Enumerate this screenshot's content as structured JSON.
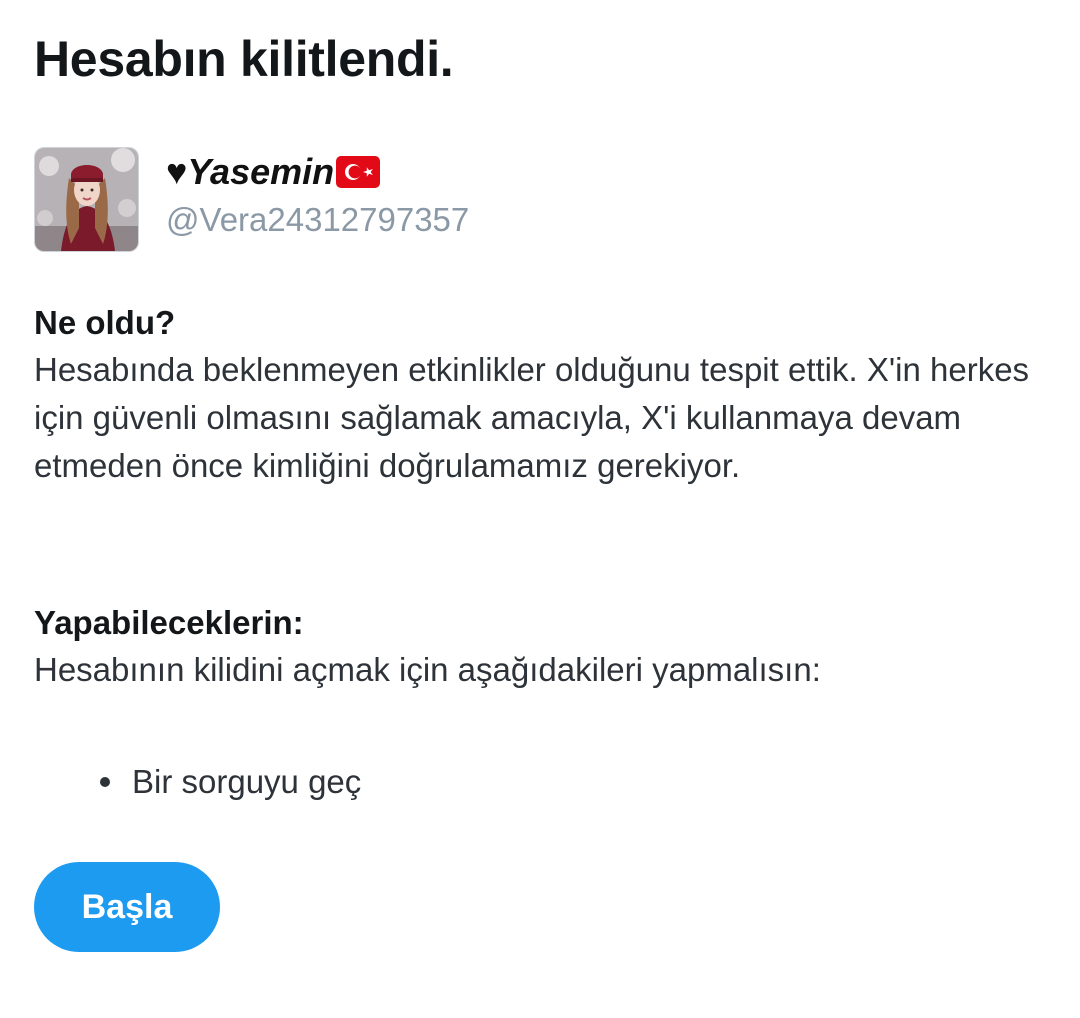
{
  "page": {
    "title": "Hesabın kilitlendi."
  },
  "profile": {
    "display_name": "♥Yasemin",
    "flag_icon": "turkey-flag-icon",
    "handle": "@Vera24312797357"
  },
  "what_happened": {
    "heading": "Ne oldu?",
    "body": "Hesabında beklenmeyen etkinlikler olduğunu tespit ettik. X'in herkes için güvenli olmasını sağlamak amacıyla, X'i kullanmaya devam etmeden önce kimliğini doğrulamamız gerekiyor."
  },
  "what_you_can_do": {
    "heading": "Yapabileceklerin:",
    "body": "Hesabının kilidini açmak için aşağıdakileri yapmalısın:",
    "steps": [
      "Bir sorguyu geç"
    ]
  },
  "actions": {
    "start_label": "Başla",
    "start_color": "#1d9bf0"
  }
}
